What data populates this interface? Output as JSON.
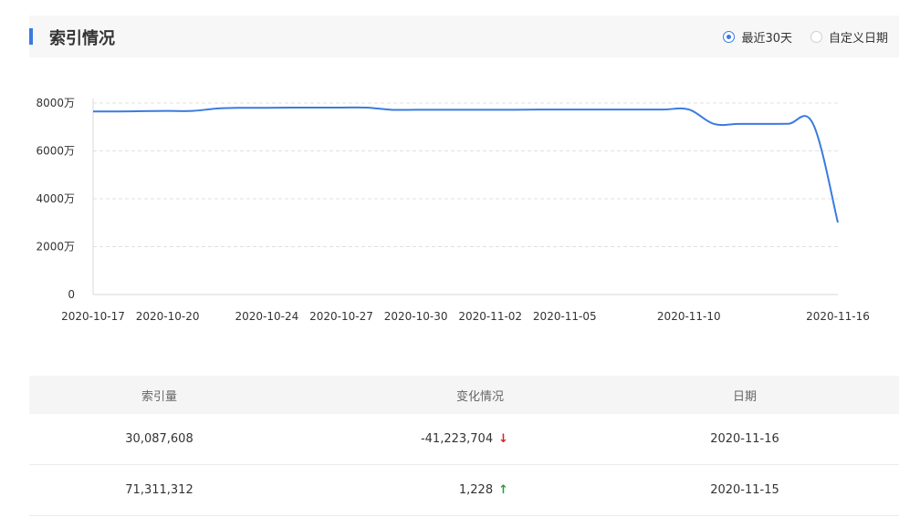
{
  "header": {
    "title": "索引情况"
  },
  "range_options": [
    {
      "label": "最近30天",
      "selected": true
    },
    {
      "label": "自定义日期",
      "selected": false
    }
  ],
  "colors": {
    "accent": "#3a7be0",
    "decrease": "#e02020",
    "increase": "#2e9a3a"
  },
  "chart_data": {
    "type": "line",
    "x_ticks": [
      "2020-10-17",
      "2020-10-20",
      "2020-10-24",
      "2020-10-27",
      "2020-10-30",
      "2020-11-02",
      "2020-11-05",
      "2020-11-10",
      "2020-11-16"
    ],
    "y_ticks": [
      "0",
      "2000万",
      "4000万",
      "6000万",
      "8000万"
    ],
    "ylim": [
      0,
      80000000
    ],
    "grid": true,
    "series": [
      {
        "x": [
          "2020-10-17",
          "2020-10-18",
          "2020-10-19",
          "2020-10-20",
          "2020-10-21",
          "2020-10-22",
          "2020-10-23",
          "2020-10-24",
          "2020-10-25",
          "2020-10-26",
          "2020-10-27",
          "2020-10-28",
          "2020-10-29",
          "2020-10-30",
          "2020-10-31",
          "2020-11-01",
          "2020-11-02",
          "2020-11-03",
          "2020-11-04",
          "2020-11-05",
          "2020-11-06",
          "2020-11-07",
          "2020-11-08",
          "2020-11-09",
          "2020-11-10",
          "2020-11-11",
          "2020-11-12",
          "2020-11-13",
          "2020-11-14",
          "2020-11-15",
          "2020-11-16"
        ],
        "values": [
          76500000,
          76500000,
          76600000,
          76700000,
          76700000,
          77700000,
          78000000,
          78000000,
          78100000,
          78100000,
          78100000,
          78100000,
          77200000,
          77200000,
          77200000,
          77200000,
          77200000,
          77200000,
          77300000,
          77300000,
          77300000,
          77300000,
          77300000,
          77300000,
          77300000,
          71300000,
          71300000,
          71300000,
          71310084,
          71311312,
          30087608
        ]
      }
    ]
  },
  "table": {
    "headers": [
      "索引量",
      "变化情况",
      "日期"
    ],
    "rows": [
      {
        "count": "30,087,608",
        "change": "-41,223,704",
        "direction": "down",
        "arrow": "↓",
        "date": "2020-11-16"
      },
      {
        "count": "71,311,312",
        "change": "1,228",
        "direction": "up",
        "arrow": "↑",
        "date": "2020-11-15"
      }
    ]
  }
}
